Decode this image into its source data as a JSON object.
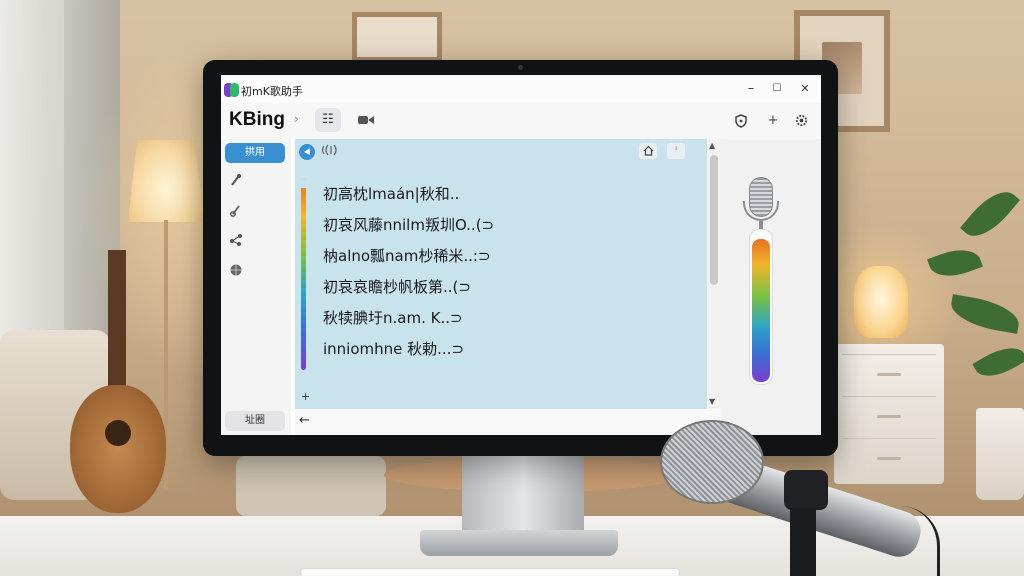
{
  "window": {
    "title": "初mK歌助手",
    "controls": {
      "minimize": "–",
      "maximize": "☐",
      "close": "✕"
    }
  },
  "toolbar": {
    "brand": "KBing",
    "chevron": "›",
    "list_icon": "☷",
    "camera_icon": "■",
    "right_icons": [
      "shield-icon",
      "plus-icon",
      "gear-icon"
    ],
    "plus": "+"
  },
  "sidebar": {
    "primary_button": "拱用",
    "items": [
      "mic-icon",
      "music-note-icon",
      "share-icon",
      "globe-icon"
    ],
    "bottom_button": "址圈"
  },
  "transcript": {
    "lines": [
      "初高枕lmaán|秋和..",
      "初哀风藤nnilm叛圳O..(⊃",
      "枘alno瓢nam杪稀米..:⊃",
      "初哀哀瞻杪帆板第..(⊃",
      "秋犊腆圩n.am. K..⊃",
      "inniomhne 秋勅...⊃"
    ],
    "level": 0.95,
    "plus_mark": "+",
    "back_arrow": "←"
  },
  "meter": {
    "level": 0.95
  },
  "colors": {
    "accent": "#3a8fd0",
    "panel_bg": "#c9e3ec",
    "level_gradient": [
      "#e8702a",
      "#f0b62b",
      "#7ac143",
      "#2ea3c7",
      "#3b6fd4",
      "#7a3fd0"
    ]
  }
}
